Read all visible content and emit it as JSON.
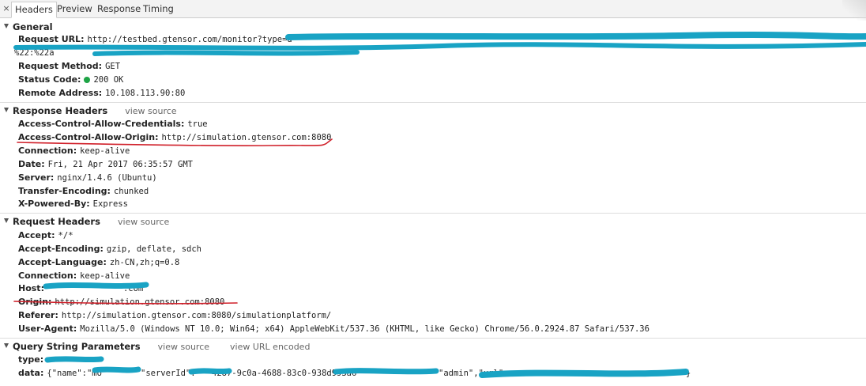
{
  "tabs": {
    "close": "×",
    "headers": "Headers",
    "preview": "Preview",
    "response": "Response",
    "timing": "Timing"
  },
  "general": {
    "title": "General",
    "request_url_key": "Request URL:",
    "request_url_val": "http://testbed.gtensor.com/monitor?type=d",
    "request_url_line2": "%22:%22a",
    "request_method_key": "Request Method:",
    "request_method_val": "GET",
    "status_code_key": "Status Code:",
    "status_code_val": "200 OK",
    "remote_address_key": "Remote Address:",
    "remote_address_val": "10.108.113.90:80"
  },
  "response_headers": {
    "title": "Response Headers",
    "view_source": "view source",
    "rows": [
      {
        "key": "Access-Control-Allow-Credentials:",
        "val": "true"
      },
      {
        "key": "Access-Control-Allow-Origin:",
        "val": "http://simulation.gtensor.com:8080"
      },
      {
        "key": "Connection:",
        "val": "keep-alive"
      },
      {
        "key": "Date:",
        "val": "Fri, 21 Apr 2017 06:35:57 GMT"
      },
      {
        "key": "Server:",
        "val": "nginx/1.4.6 (Ubuntu)"
      },
      {
        "key": "Transfer-Encoding:",
        "val": "chunked"
      },
      {
        "key": "X-Powered-By:",
        "val": "Express"
      }
    ]
  },
  "request_headers": {
    "title": "Request Headers",
    "view_source": "view source",
    "rows": [
      {
        "key": "Accept:",
        "val": "*/*"
      },
      {
        "key": "Accept-Encoding:",
        "val": "gzip, deflate, sdch"
      },
      {
        "key": "Accept-Language:",
        "val": "zh-CN,zh;q=0.8"
      },
      {
        "key": "Connection:",
        "val": "keep-alive"
      },
      {
        "key": "Host:",
        "val": ".com"
      },
      {
        "key": "Origin:",
        "val": "http://simulation.gtensor.com:8080"
      },
      {
        "key": "Referer:",
        "val": "http://simulation.gtensor.com:8080/simulationplatform/"
      },
      {
        "key": "User-Agent:",
        "val": "Mozilla/5.0 (Windows NT 10.0; Win64; x64) AppleWebKit/537.36 (KHTML, like Gecko) Chrome/56.0.2924.87 Safari/537.36"
      }
    ]
  },
  "query_params": {
    "title": "Query String Parameters",
    "view_source": "view source",
    "view_url_encoded": "view URL encoded",
    "rows": [
      {
        "key": "type:",
        "val": ""
      },
      {
        "key": "data:",
        "val": "{\"name\":\"mo",
        "val_mid": "\"serverId\":\"",
        "val_mid2": "4287-9c0a-4688-83c0-938d993a6",
        "val_mid3": "\"admin\",\"url\":",
        "val_end": "}"
      }
    ]
  },
  "colors": {
    "scribble": "#19a3c4",
    "underline": "#d0202a",
    "status_ok": "#1ea446"
  }
}
